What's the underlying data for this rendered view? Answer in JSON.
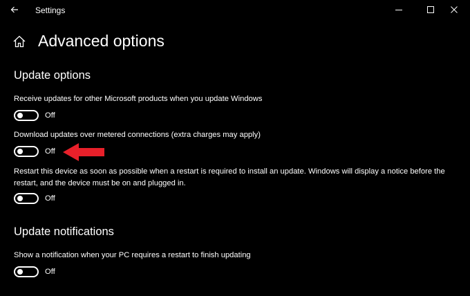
{
  "window": {
    "title": "Settings"
  },
  "page": {
    "title": "Advanced options"
  },
  "sections": {
    "update_options": {
      "title": "Update options",
      "settings": [
        {
          "label": "Receive updates for other Microsoft products when you update Windows",
          "state": "Off"
        },
        {
          "label": "Download updates over metered connections (extra charges may apply)",
          "state": "Off"
        },
        {
          "label": "Restart this device as soon as possible when a restart is required to install an update. Windows will display a notice before the restart, and the device must be on and plugged in.",
          "state": "Off"
        }
      ]
    },
    "update_notifications": {
      "title": "Update notifications",
      "settings": [
        {
          "label": "Show a notification when your PC requires a restart to finish updating",
          "state": "Off"
        }
      ]
    }
  },
  "icons": {
    "back": "back-arrow-icon",
    "home": "home-icon",
    "minimize": "minimize-icon",
    "maximize": "maximize-icon",
    "close": "close-icon",
    "annotation": "red-arrow-icon"
  },
  "colors": {
    "background": "#000000",
    "foreground": "#ffffff",
    "annotation": "#e8202a"
  }
}
